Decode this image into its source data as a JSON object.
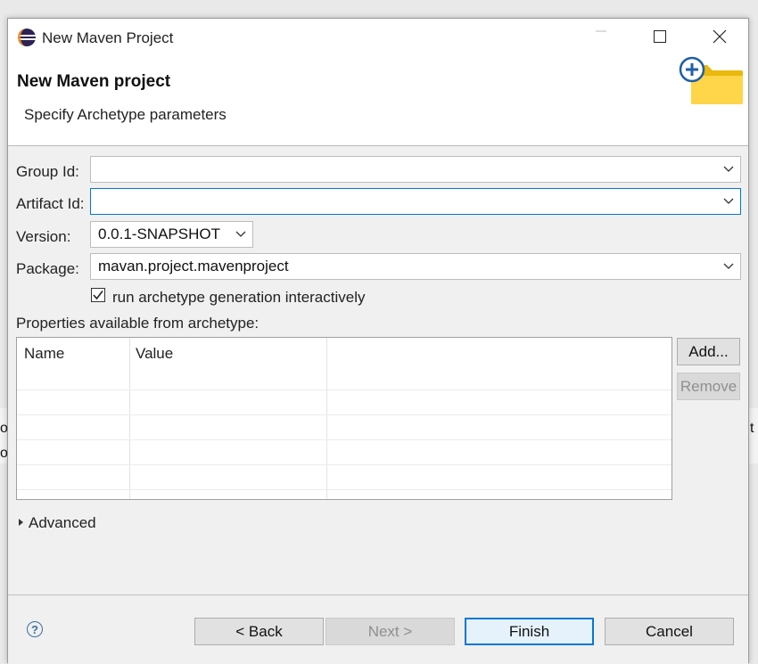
{
  "window": {
    "title": "New Maven Project",
    "controls": {
      "minimize": "minimize-icon",
      "maximize": "maximize-icon",
      "close": "close-icon"
    }
  },
  "header": {
    "title": "New Maven project",
    "subtitle": "Specify Archetype parameters",
    "icon": "new-folder-icon"
  },
  "form": {
    "group_id": {
      "label": "Group Id:",
      "value": ""
    },
    "artifact_id": {
      "label": "Artifact Id:",
      "value": ""
    },
    "version": {
      "label": "Version:",
      "value": "0.0.1-SNAPSHOT"
    },
    "package": {
      "label": "Package:",
      "value": "mavan.project.mavenproject"
    },
    "interactive": {
      "label": "run archetype generation interactively",
      "checked": true
    }
  },
  "properties": {
    "label": "Properties available from archetype:",
    "columns": [
      "Name",
      "Value"
    ],
    "rows": [],
    "add_label": "Add...",
    "remove_label": "Remove"
  },
  "advanced": {
    "label": "Advanced"
  },
  "buttons": {
    "back": "< Back",
    "next": "Next >",
    "finish": "Finish",
    "cancel": "Cancel"
  },
  "background": {
    "left_fragment_1": "o",
    "left_fragment_2": "or",
    "right_fragment": "t"
  },
  "colors": {
    "accent": "#0078d7",
    "header_bg": "#ffffff",
    "dialog_bg": "#f0f0f0"
  }
}
